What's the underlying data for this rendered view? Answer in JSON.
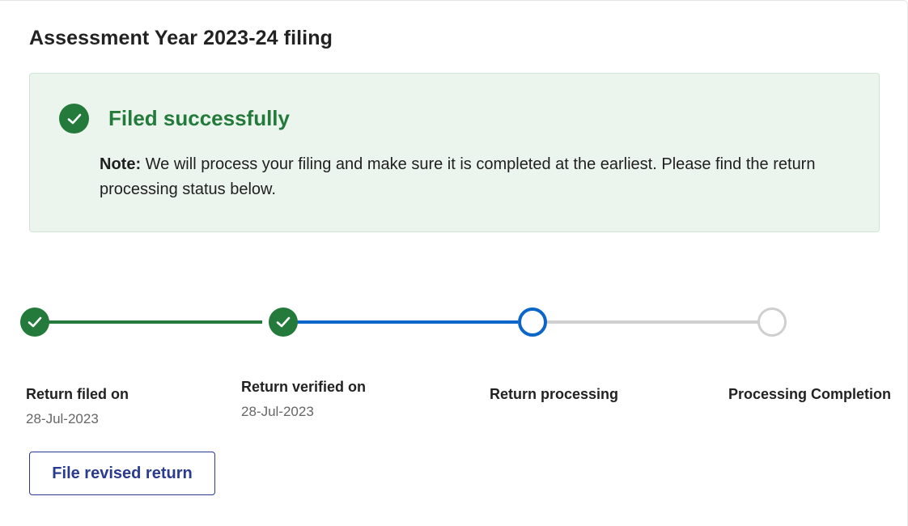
{
  "page": {
    "title": "Assessment Year 2023-24 filing"
  },
  "status_panel": {
    "title": "Filed successfully",
    "note_label": "Note:",
    "note_text": " We will process your filing and make sure it is completed at the earliest. Please find the return processing status below.",
    "icon": "check-circle-icon"
  },
  "timeline": {
    "steps": [
      {
        "label": "Return filed on",
        "date": "28-Jul-2023",
        "state": "done",
        "icon": "check-icon"
      },
      {
        "label": "Return verified on",
        "date": "28-Jul-2023",
        "state": "done",
        "icon": "check-icon"
      },
      {
        "label": "Return processing",
        "date": "",
        "state": "current"
      },
      {
        "label": "Processing Completion",
        "date": "",
        "state": "pending"
      }
    ]
  },
  "actions": {
    "file_revised_label": "File revised return"
  },
  "colors": {
    "success_green": "#237a3b",
    "progress_blue": "#0b66c7",
    "pending_gray": "#cfcfcf",
    "panel_bg": "#ebf5ed",
    "button_blue": "#2a3b8f"
  }
}
